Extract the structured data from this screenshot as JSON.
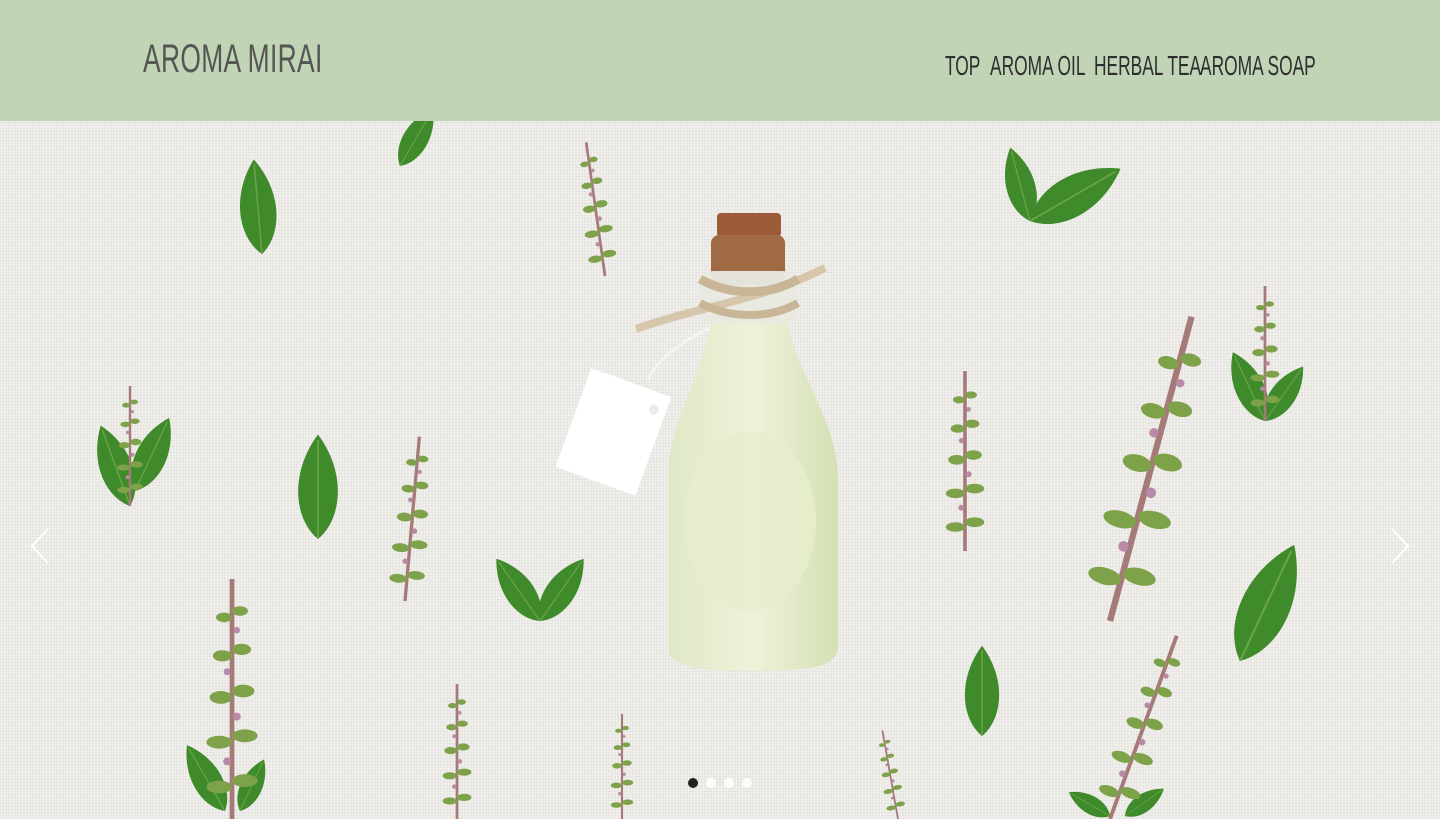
{
  "header": {
    "logo": "AROMA MIRAI",
    "nav": [
      "TOP",
      "AROMA OIL",
      "HERBAL TEA",
      "AROMA SOAP"
    ]
  },
  "slider": {
    "slide_count": 4,
    "active_slide": 1,
    "image_description_icon": "essential-oil-bottle-with-basil-leaves"
  },
  "colors": {
    "header_bg": "#c1d4b5",
    "logo_text": "#555555",
    "nav_text": "#2e2e2e",
    "leaf_green": "#3f8a2a",
    "linen_bg": "#ecebe7"
  }
}
